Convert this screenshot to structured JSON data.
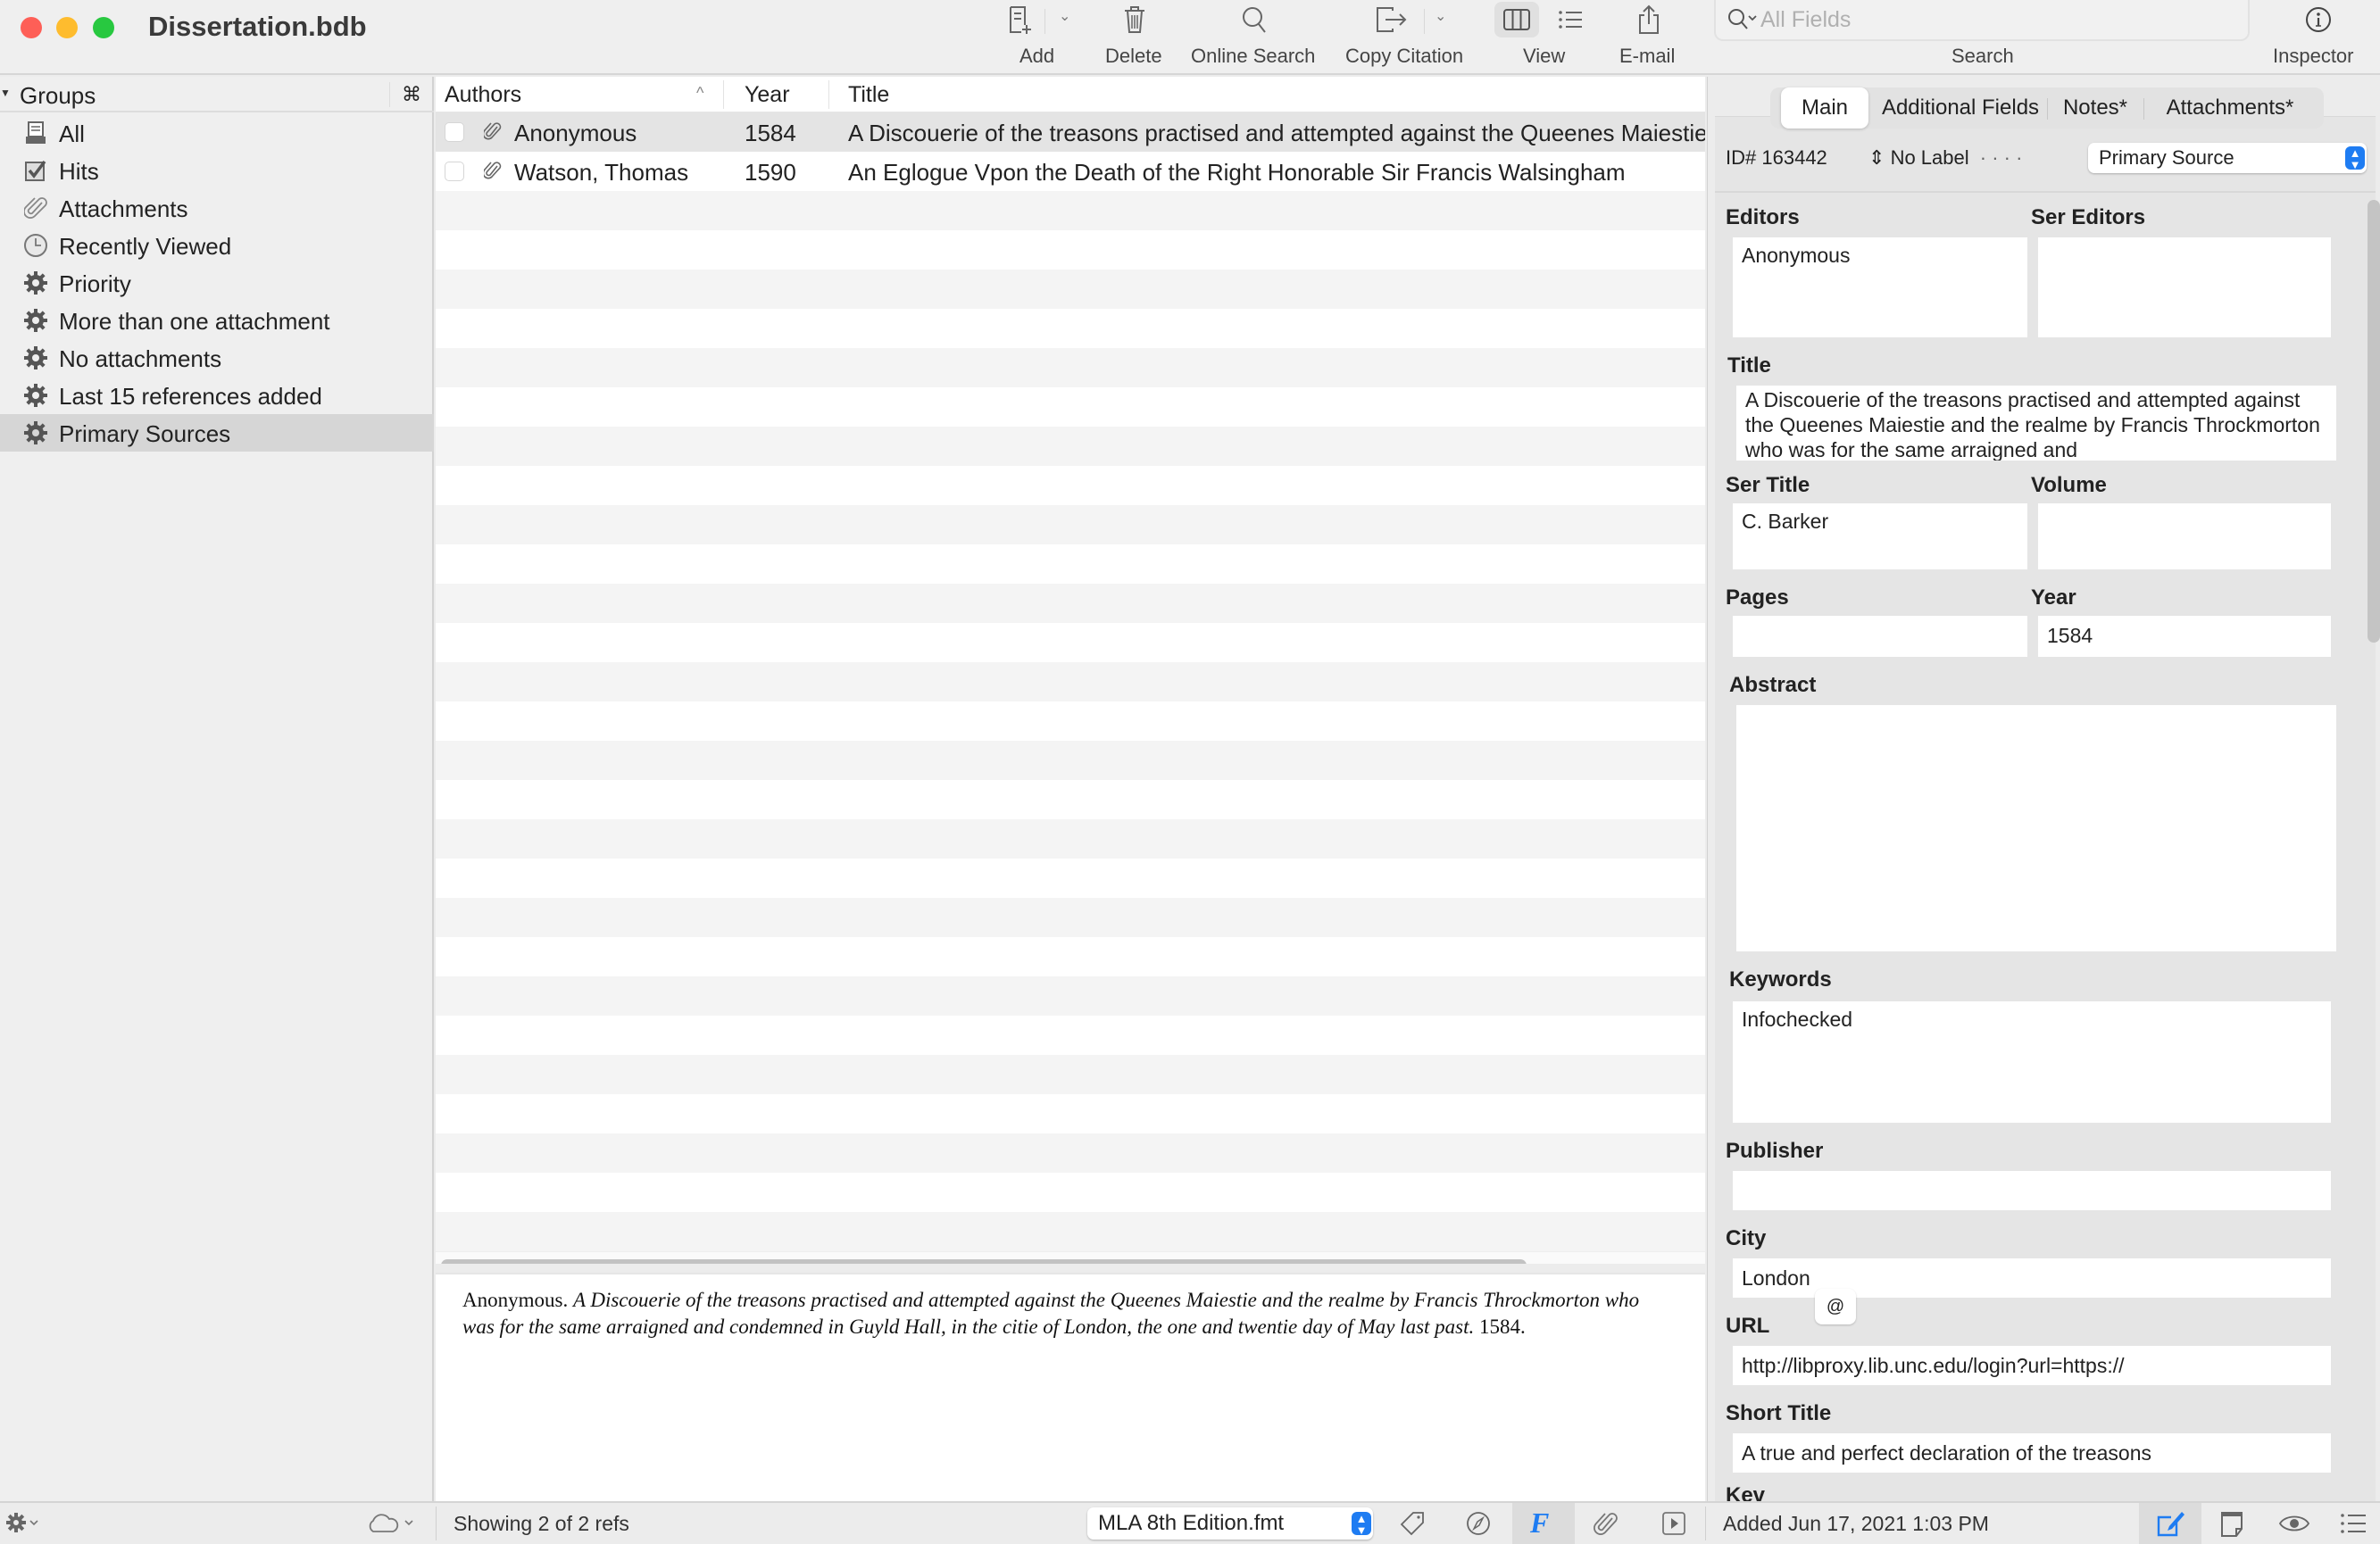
{
  "window": {
    "title": "Dissertation.bdb"
  },
  "toolbar": {
    "add_label": "Add",
    "delete_label": "Delete",
    "online_search_label": "Online Search",
    "copy_citation_label": "Copy Citation",
    "view_label": "View",
    "email_label": "E-mail",
    "search_label": "Search",
    "search_placeholder": "All Fields",
    "inspector_label": "Inspector"
  },
  "sidebar": {
    "header": "Groups",
    "header_shortcut": "⌘",
    "items": [
      {
        "label": "All",
        "icon": "library-icon"
      },
      {
        "label": "Hits",
        "icon": "checkbox-icon"
      },
      {
        "label": "Attachments",
        "icon": "paperclip-icon"
      },
      {
        "label": "Recently Viewed",
        "icon": "clock-icon"
      },
      {
        "label": "Priority",
        "icon": "gear-icon"
      },
      {
        "label": "More than one attachment",
        "icon": "gear-icon"
      },
      {
        "label": "No attachments",
        "icon": "gear-icon"
      },
      {
        "label": "Last 15 references added",
        "icon": "gear-icon"
      },
      {
        "label": "Primary Sources",
        "icon": "gear-icon",
        "selected": true
      }
    ]
  },
  "table": {
    "columns": [
      "Authors",
      "Year",
      "Title"
    ],
    "rows": [
      {
        "author": "Anonymous",
        "year": "1584",
        "title": "A Discouerie of the treasons practised and attempted against the Queenes Maiestie",
        "selected": true
      },
      {
        "author": "Watson, Thomas",
        "year": "1590",
        "title": "An Eglogue Vpon the Death of the Right Honorable Sir Francis Walsingham",
        "selected": false
      }
    ]
  },
  "preview": {
    "author": "Anonymous.",
    "title_italic": "A Discouerie of the treasons practised and attempted against the Queenes Maiestie and the realme by Francis Throckmorton who was for the same arraigned and condemned in Guyld Hall, in the citie of London, the one and twentie day of May last past.",
    "year": "1584."
  },
  "inspector": {
    "tabs": [
      "Main",
      "Additional Fields",
      "Notes*",
      "Attachments*"
    ],
    "active_tab": "Main",
    "id_label": "ID#",
    "id_value": "163442",
    "label_value": "No Label",
    "label_dots": "· · · ·",
    "type_value": "Primary Source",
    "fields": {
      "editors": {
        "label": "Editors",
        "value": "Anonymous"
      },
      "ser_editors": {
        "label": "Ser Editors",
        "value": ""
      },
      "title": {
        "label": "Title",
        "value": "A Discouerie of the treasons practised and attempted against the Queenes Maiestie and the realme by Francis Throckmorton who was for the same arraigned and"
      },
      "ser_title": {
        "label": "Ser Title",
        "value": "C. Barker"
      },
      "volume": {
        "label": "Volume",
        "value": ""
      },
      "pages": {
        "label": "Pages",
        "value": ""
      },
      "year": {
        "label": "Year",
        "value": "1584"
      },
      "abstract": {
        "label": "Abstract",
        "value": ""
      },
      "keywords": {
        "label": "Keywords",
        "value": "Infochecked"
      },
      "publisher": {
        "label": "Publisher",
        "value": ""
      },
      "city": {
        "label": "City",
        "value": "London"
      },
      "url": {
        "label": "URL",
        "value": "http://libproxy.lib.unc.edu/login?url=https://",
        "button": "@"
      },
      "short_title": {
        "label": "Short Title",
        "value": "A true and perfect declaration of the treasons"
      },
      "key": {
        "label": "Kev"
      }
    }
  },
  "statusbar": {
    "count_text": "Showing 2 of 2 refs",
    "style_value": "MLA 8th Edition.fmt",
    "added_text": "Added Jun 17, 2021 1:03 PM"
  },
  "colors": {
    "accent": "#1e7cf2",
    "close": "#fe5f57",
    "minimize": "#febc2e",
    "zoom": "#28c840"
  }
}
